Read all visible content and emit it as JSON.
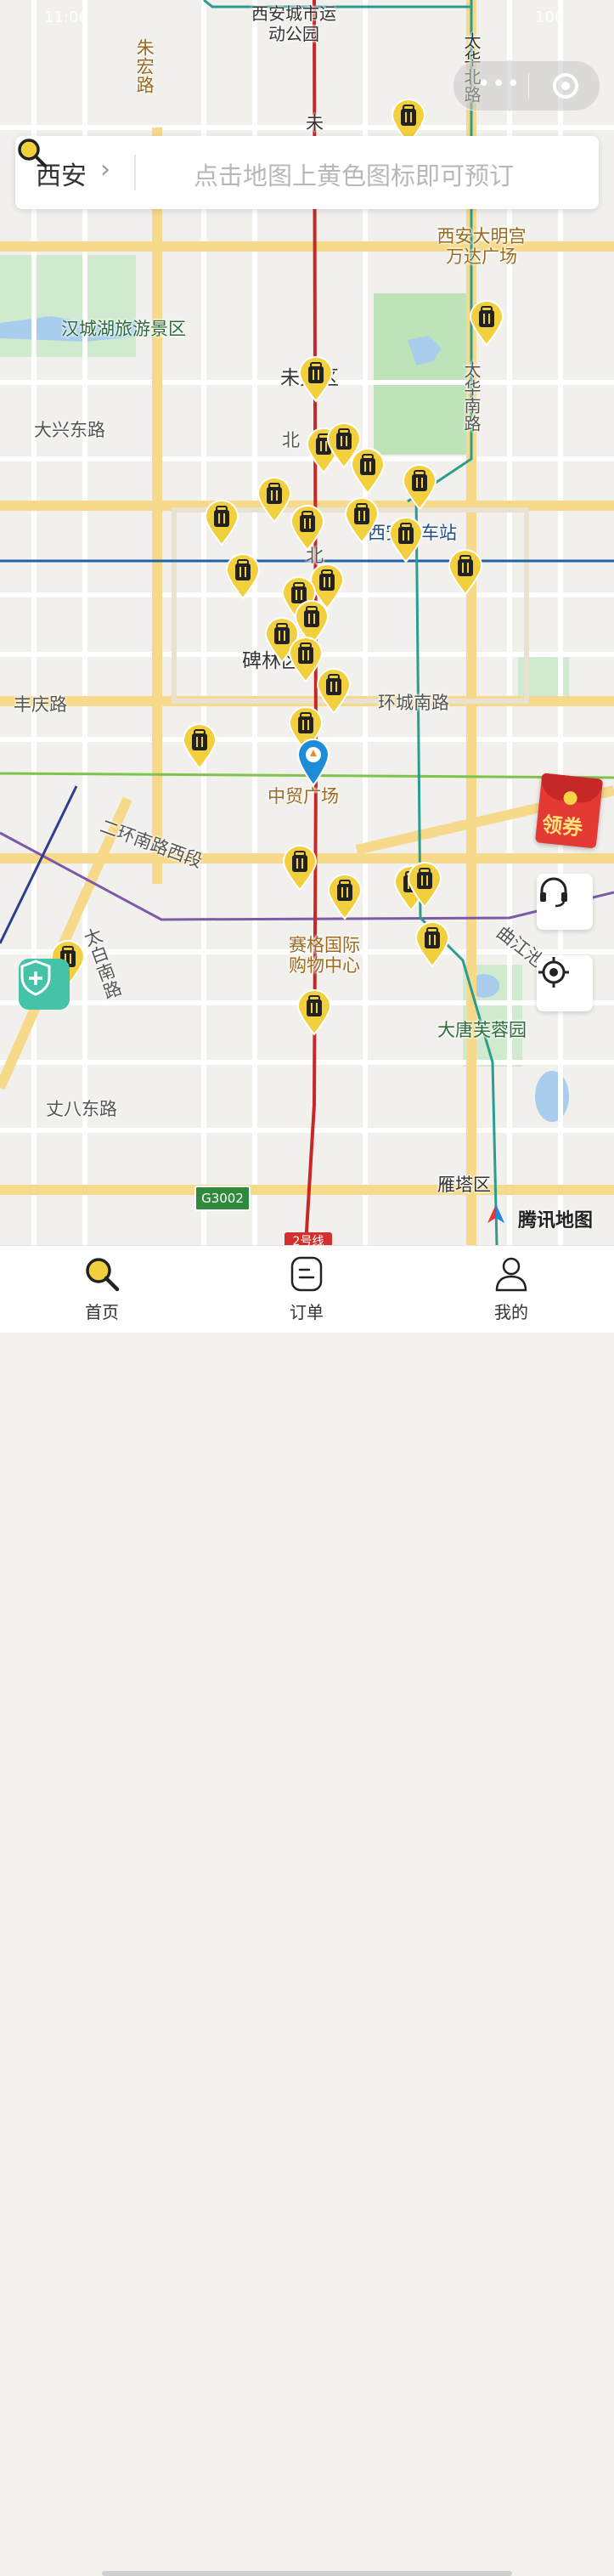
{
  "status_bar": {
    "time": "11:06",
    "battery": "100"
  },
  "search": {
    "city": "西安",
    "chevron": "›",
    "placeholder": "点击地图上黄色图标即可预订"
  },
  "map": {
    "labels": [
      "西安城市运动公园",
      "朱宏路",
      "太华北路",
      "未",
      "西安大明宫万达广场",
      "汉城湖旅游景区",
      "未央区",
      "大兴东路",
      "太华南路",
      "北",
      "西安火车站",
      "北",
      "碑林区",
      "丰庆路",
      "环城南路",
      "中贸广场",
      "二环南路西段",
      "赛格国际购物中心",
      "曲江池",
      "太白南路",
      "大唐芙蓉园",
      "丈八东路",
      "雁塔区"
    ],
    "route_badges": {
      "highway": "G3002",
      "metro": "2号线"
    },
    "attribution": "腾讯地图"
  },
  "coupon": {
    "label": "领券"
  },
  "controls": {
    "service_icon": "headset-icon",
    "locate_icon": "crosshair-icon",
    "safety_icon": "shield-plus-icon"
  },
  "tabs": [
    {
      "label": "首页",
      "icon": "search-icon",
      "active": true
    },
    {
      "label": "订单",
      "icon": "order-icon",
      "active": false
    },
    {
      "label": "我的",
      "icon": "user-icon",
      "active": false
    }
  ],
  "colors": {
    "accent": "#f2cf3c",
    "pin_fill": "#f2cf3c",
    "pin_icon": "#222222",
    "location_pin": "#1e8bd6"
  }
}
